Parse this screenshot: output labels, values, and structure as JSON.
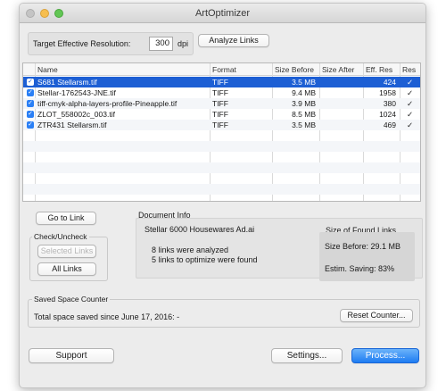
{
  "window": {
    "title": "ArtOptimizer"
  },
  "resolution": {
    "label": "Target Effective Resolution:",
    "value": "300",
    "unit": "dpi",
    "analyze_button": "Analyze Links"
  },
  "table": {
    "columns": [
      "Name",
      "Format",
      "Size Before",
      "Size After",
      "Eff. Res",
      "Res"
    ],
    "rows": [
      {
        "checked": "✓",
        "name": "S681 Stellarsm.tif",
        "format": "TIFF",
        "size_before": "3.5 MB",
        "size_after": "",
        "eff_res": "424",
        "res": "✓"
      },
      {
        "checked": "✓",
        "name": "Stellar-1762543-JNE.tif",
        "format": "TIFF",
        "size_before": "9.4 MB",
        "size_after": "",
        "eff_res": "1958",
        "res": "✓"
      },
      {
        "checked": "✓",
        "name": "tiff-cmyk-alpha-layers-profile-Pineapple.tif",
        "format": "TIFF",
        "size_before": "3.9 MB",
        "size_after": "",
        "eff_res": "380",
        "res": "✓"
      },
      {
        "checked": "✓",
        "name": "ZLOT_558002c_003.tif",
        "format": "TIFF",
        "size_before": "8.5 MB",
        "size_after": "",
        "eff_res": "1024",
        "res": "✓"
      },
      {
        "checked": "✓",
        "name": "ZTR431 Stellarsm.tif",
        "format": "TIFF",
        "size_before": "3.5 MB",
        "size_after": "",
        "eff_res": "469",
        "res": "✓"
      }
    ]
  },
  "controls": {
    "go_to_link": "Go to Link",
    "check_uncheck_title": "Check/Uncheck",
    "selected_links": "Selected Links",
    "all_links": "All Links"
  },
  "document_info": {
    "title": "Document Info",
    "document_name": "Stellar 6000 Housewares Ad.ai",
    "links_analyzed": "8 links were analyzed",
    "links_to_optimize": "5 links to optimize were found",
    "found_links_title": "Size of Found Links",
    "size_before": "Size Before: 29.1 MB",
    "estim_saving": "Estim. Saving: 83%"
  },
  "saved_space": {
    "title": "Saved Space Counter",
    "text": "Total space saved since June 17, 2016: -",
    "reset_button": "Reset Counter..."
  },
  "footer": {
    "support": "Support",
    "settings": "Settings...",
    "process": "Process..."
  },
  "colors": {
    "selection": "#1d5fd4",
    "checkbox": "#2a7ff5",
    "primary_button": "#1e7cf2"
  }
}
